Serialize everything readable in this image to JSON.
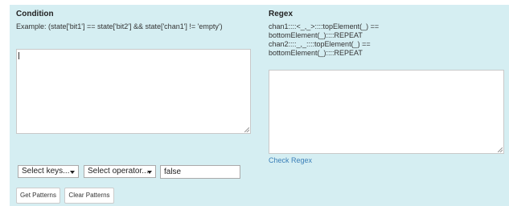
{
  "condition": {
    "heading": "Condition",
    "example": "Example: (state['bit1'] == state['bit2'] && state['chan1'] != 'empty')",
    "textarea_value": ""
  },
  "regex": {
    "heading": "Regex",
    "lines": [
      "chan1::::<_,_>::::topElement(_) ==",
      "bottomElement(_)::::REPEAT",
      "chan2::::_,_::::topElement(_) ==",
      "bottomElement(_)::::REPEAT"
    ],
    "textarea_value": "",
    "check_link": "Check Regex"
  },
  "controls": {
    "keys_select": "Select keys...",
    "operator_select": "Select operator...",
    "value_input": "false"
  },
  "buttons": {
    "get_patterns": "Get Patterns",
    "clear_patterns": "Clear Patterns"
  },
  "colors": {
    "panel_background": "#d5eef2",
    "link": "#3b7fb8"
  }
}
